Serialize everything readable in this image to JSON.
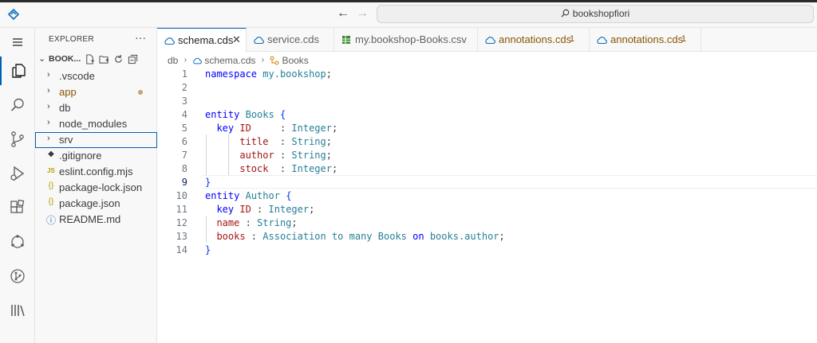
{
  "titlebar": {
    "search_text": "bookshopfiori",
    "back_icon": "arrow-left-icon",
    "forward_icon": "arrow-right-icon"
  },
  "activity": [
    "explorer-icon",
    "search-icon",
    "source-control-icon",
    "run-debug-icon",
    "extensions-icon",
    "remote-explorer-icon",
    "git-graph-icon",
    "library-icon"
  ],
  "sidebar": {
    "title": "EXPLORER",
    "more": "···",
    "project": "BOOK...",
    "items": [
      {
        "label": ".vscode",
        "type": "folder"
      },
      {
        "label": "app",
        "type": "folder"
      },
      {
        "label": "db",
        "type": "folder"
      },
      {
        "label": "node_modules",
        "type": "folder"
      },
      {
        "label": "srv",
        "type": "folder"
      },
      {
        "label": ".gitignore",
        "type": "file",
        "icon": "◆"
      },
      {
        "label": "eslint.config.mjs",
        "type": "file",
        "icon": "JS"
      },
      {
        "label": "package-lock.json",
        "type": "file",
        "icon": "{}"
      },
      {
        "label": "package.json",
        "type": "file",
        "icon": "{}"
      },
      {
        "label": "README.md",
        "type": "file",
        "icon": "ⓘ"
      }
    ]
  },
  "tabs": [
    {
      "label": "schema.cds",
      "close": "✕"
    },
    {
      "label": "service.cds"
    },
    {
      "label": "my.bookshop-Books.csv"
    },
    {
      "label": "annotations.cds",
      "badge": "1"
    },
    {
      "label": "annotations.cds",
      "badge": "1"
    }
  ],
  "breadcrumb": {
    "folder": "db",
    "file": "schema.cds",
    "symbol": "Books",
    "sep": "›"
  },
  "editor": {
    "line_numbers": [
      "1",
      "2",
      "3",
      "4",
      "5",
      "6",
      "7",
      "8",
      "9",
      "10",
      "11",
      "12",
      "13",
      "14"
    ],
    "namespace_kw": "namespace",
    "namespace_name": "my.bookshop",
    "entity_kw": "entity",
    "key_kw": "key",
    "books": {
      "name": "Books",
      "fields": [
        {
          "name": "ID",
          "type": "Integer"
        },
        {
          "name": "title",
          "type": "String"
        },
        {
          "name": "author",
          "type": "String"
        },
        {
          "name": "stock",
          "type": "Integer"
        }
      ]
    },
    "author": {
      "name": "Author",
      "id": "ID",
      "id_type": "Integer",
      "name_field": "name",
      "name_type": "String",
      "assoc_field": "books",
      "assoc_kw": "Association to many",
      "assoc_target": "Books",
      "on_kw": "on",
      "on_ref": "books.author"
    }
  },
  "colors": {
    "accent": "#005fb8",
    "keyword": "#0000ff",
    "type": "#267f99",
    "property": "#a31515",
    "warning": "#895503"
  }
}
